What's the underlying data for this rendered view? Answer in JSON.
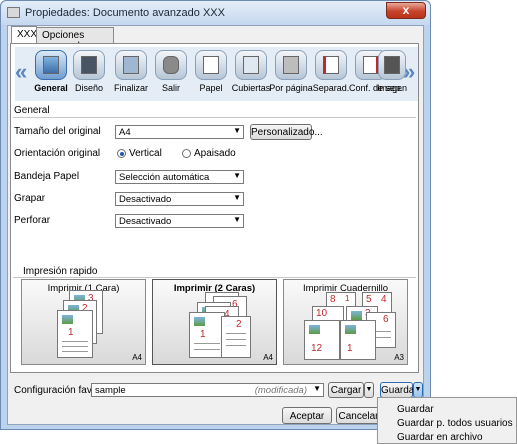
{
  "window": {
    "title": "Propiedades: Documento avanzado XXX",
    "close_glyph": "x"
  },
  "tabs": [
    {
      "label": "XXX"
    },
    {
      "label": "Opciones avanzadas"
    }
  ],
  "toolbar": {
    "prev_arrow": "«",
    "next_arrow": "»",
    "items": [
      {
        "label": "General",
        "icon": "general-icon"
      },
      {
        "label": "Diseño",
        "icon": "layout-icon"
      },
      {
        "label": "Finalizar",
        "icon": "finishing-icon"
      },
      {
        "label": "Salir",
        "icon": "output-icon"
      },
      {
        "label": "Papel",
        "icon": "paper-icon"
      },
      {
        "label": "Cubiertas",
        "icon": "covers-icon"
      },
      {
        "label": "Por página",
        "icon": "per-page-icon"
      },
      {
        "label": "Separad.",
        "icon": "separator-icon"
      },
      {
        "label": "Conf. de sep.",
        "icon": "separator-config-icon"
      },
      {
        "label": "Imagen",
        "icon": "image-icon"
      }
    ]
  },
  "general": {
    "section_title": "General",
    "original_size": {
      "label": "Tamaño del original",
      "value": "A4",
      "button": "Personalizado..."
    },
    "orientation": {
      "label": "Orientación original",
      "vertical": "Vertical",
      "horizontal": "Apaisado",
      "selected": "Vertical"
    },
    "tray": {
      "label": "Bandeja Papel",
      "value": "Selección automática"
    },
    "staple": {
      "label": "Grapar",
      "value": "Desactivado"
    },
    "punch": {
      "label": "Perforar",
      "value": "Desactivado"
    }
  },
  "quick_print": {
    "title": "Impresión rapido",
    "options": [
      {
        "label": "Imprimir (1 Cara)",
        "size": "A4",
        "pages": [
          "3",
          "2",
          "1"
        ]
      },
      {
        "label": "Imprimir (2 Caras)",
        "size": "A4",
        "pages": [
          "5",
          "6",
          "3",
          "4",
          "1",
          "2"
        ]
      },
      {
        "label": "Imprimir Cuadernillo",
        "size": "A3",
        "pages": [
          "8",
          "1",
          "5",
          "4",
          "10",
          "3",
          "6",
          "12",
          "1"
        ]
      }
    ]
  },
  "favorites": {
    "label": "Configuración favorita",
    "value": "sample",
    "status": "(modificada)",
    "load": "Cargar",
    "save": "Guardar"
  },
  "dialog_buttons": {
    "ok": "Aceptar",
    "cancel": "Cancelar"
  },
  "save_menu": {
    "items": [
      "Guardar",
      "Guardar p. todos usuarios",
      "Guardar en archivo"
    ]
  },
  "colors": {
    "accent": "#3b6ea8",
    "page_number": "#c0282d",
    "window_frame": "#bcd3ee"
  }
}
